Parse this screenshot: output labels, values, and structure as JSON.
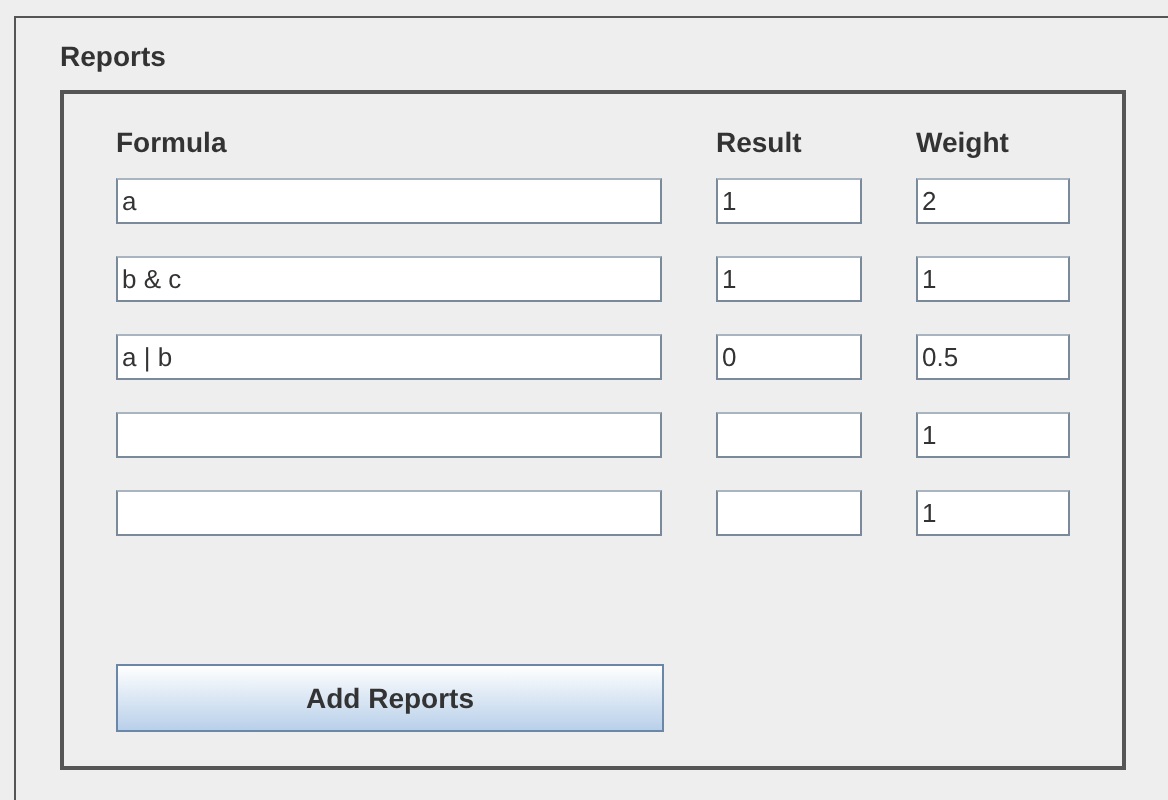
{
  "panel": {
    "title": "Reports"
  },
  "columns": [
    "Formula",
    "Result",
    "Weight"
  ],
  "rows": [
    {
      "formula": "a",
      "result": "1",
      "weight": "2"
    },
    {
      "formula": "b & c",
      "result": "1",
      "weight": "1"
    },
    {
      "formula": "a | b",
      "result": "0",
      "weight": "0.5"
    },
    {
      "weight": "1"
    },
    {
      "weight": "1"
    }
  ],
  "button": {
    "label": "Add Reports"
  }
}
